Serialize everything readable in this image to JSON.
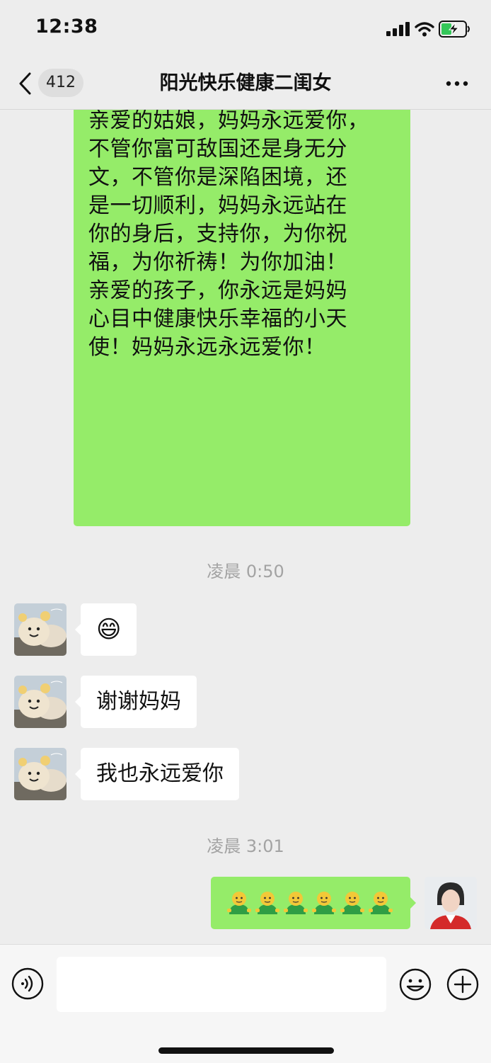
{
  "status_bar": {
    "time": "12:38"
  },
  "header": {
    "unread_count": "412",
    "title": "阳光快乐健康二闺女"
  },
  "messages": {
    "long_text": "怎可与价值定义。\n亲爱的姑娘，妈妈永远爱你，\n不管你富可敌国还是身无分\n文，不管你是深陷困境，还\n是一切顺利，妈妈永远站在\n你的身后，支持你，为你祝\n福，为你祈祷！为你加油！\n亲爱的孩子，你永远是妈妈\n心目中健康快乐幸福的小天\n使！妈妈永远永远爱你！",
    "timestamp_1": "凌晨 0:50",
    "reply_1": "😄",
    "reply_2": "谢谢妈妈",
    "reply_3": "我也永远爱你",
    "timestamp_2": "凌晨 3:01",
    "sent_emoji_count": 6
  },
  "input": {
    "placeholder": ""
  },
  "icons": {
    "back": "chevron-left-icon",
    "more": "more-dots-icon",
    "voice": "voice-icon",
    "emoji": "emoji-icon",
    "plus": "plus-icon"
  },
  "colors": {
    "sent_bubble": "#95ec69",
    "received_bubble": "#ffffff",
    "background": "#ededed"
  }
}
